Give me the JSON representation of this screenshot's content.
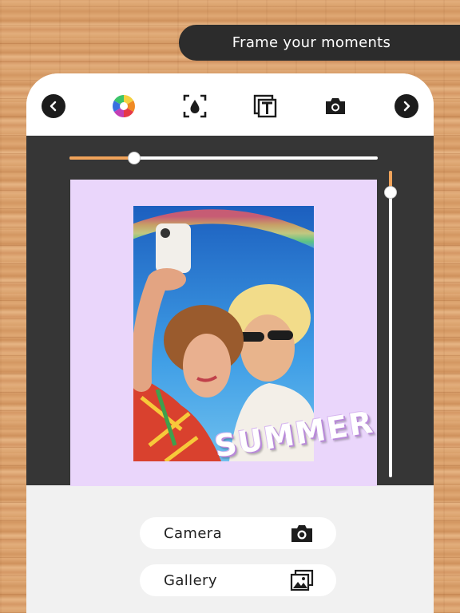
{
  "banner": {
    "text": "Frame your moments"
  },
  "toolbar": {
    "icons": [
      "back-chevron-icon",
      "color-wheel-icon",
      "drop-focus-icon",
      "text-frame-icon",
      "camera-icon",
      "forward-chevron-icon"
    ]
  },
  "sliders": {
    "horizontal_level": 0.21,
    "vertical_level": 0.07,
    "accent_color": "#f0a35a"
  },
  "frame": {
    "background_color": "#ead6fb"
  },
  "sticker": {
    "text": "SUMMER"
  },
  "actions": {
    "camera_label": "Camera",
    "gallery_label": "Gallery"
  }
}
